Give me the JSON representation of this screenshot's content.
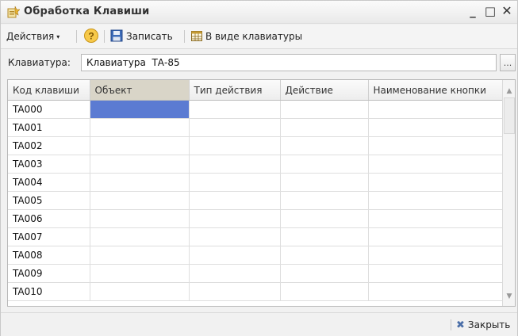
{
  "window": {
    "title": "Обработка  Клавиши",
    "controls": {
      "minimize": "_",
      "maximize": "□",
      "close": "✕"
    }
  },
  "toolbar": {
    "actions_label": "Действия",
    "actions_caret": "▾",
    "help_symbol": "?",
    "save_label": "Записать",
    "keyboard_view_label": "В виде клавиатуры"
  },
  "keyboard_field": {
    "label": "Клавиатура:",
    "value": "Клавиатура  ТА-85",
    "button": "..."
  },
  "table": {
    "columns": [
      "Код клавиши",
      "Объект",
      "Тип действия",
      "Действие",
      "Наименование кнопки"
    ],
    "rows": [
      [
        "TA000",
        "",
        "",
        "",
        ""
      ],
      [
        "TA001",
        "",
        "",
        "",
        ""
      ],
      [
        "TA002",
        "",
        "",
        "",
        ""
      ],
      [
        "TA003",
        "",
        "",
        "",
        ""
      ],
      [
        "TA004",
        "",
        "",
        "",
        ""
      ],
      [
        "TA005",
        "",
        "",
        "",
        ""
      ],
      [
        "TA006",
        "",
        "",
        "",
        ""
      ],
      [
        "TA007",
        "",
        "",
        "",
        ""
      ],
      [
        "TA008",
        "",
        "",
        "",
        ""
      ],
      [
        "TA009",
        "",
        "",
        "",
        ""
      ],
      [
        "TA010",
        "",
        "",
        "",
        ""
      ]
    ],
    "selected_cell": {
      "row": 0,
      "column": 1
    },
    "scroll_up": "▲",
    "scroll_down": "▼"
  },
  "footer": {
    "close_icon": "✖",
    "close_label": "Закрыть"
  },
  "colors": {
    "selection": "#5b7bd2",
    "active_header": "#d9d5c8",
    "close_icon": "#4a6ea8"
  },
  "icons": {
    "title": "processing-icon",
    "help": "help-icon",
    "save": "floppy-icon",
    "keyboard": "keyboard-icon",
    "close": "close-x-icon"
  }
}
